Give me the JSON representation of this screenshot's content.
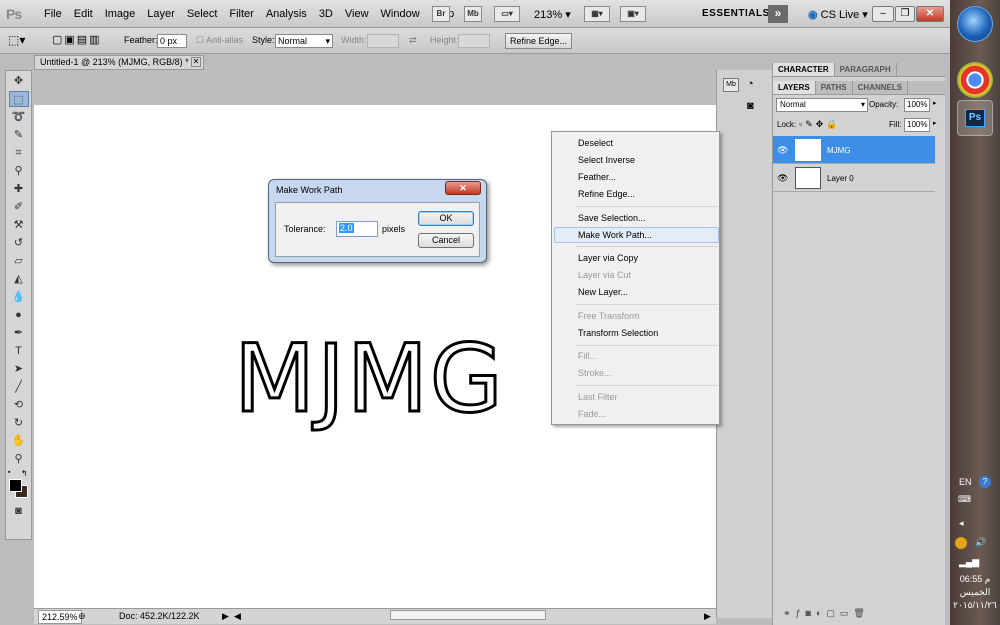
{
  "menubar": {
    "logo": "Ps",
    "menus": [
      "File",
      "Edit",
      "Image",
      "Layer",
      "Select",
      "Filter",
      "Analysis",
      "3D",
      "View",
      "Window",
      "Help"
    ],
    "bridge_icon": "Br",
    "minibridge_icon": "Mb",
    "zoom": "213%",
    "workspace": "ESSENTIALS",
    "cs_live": "CS Live"
  },
  "options": {
    "feather_label": "Feather:",
    "feather_value": "0 px",
    "antialias_label": "Anti-alias",
    "style_label": "Style:",
    "style_value": "Normal",
    "width_label": "Width:",
    "height_label": "Height:",
    "refine_button": "Refine Edge..."
  },
  "document": {
    "tab_title": "Untitled-1 @ 213% (MJMG, RGB/8) *",
    "canvas_text": "MJMG",
    "status_zoom": "212.59%",
    "status_doc": "Doc: 452.2K/122.2K"
  },
  "context_menu": {
    "items": [
      {
        "label": "Deselect",
        "enabled": true
      },
      {
        "label": "Select Inverse",
        "enabled": true
      },
      {
        "label": "Feather...",
        "enabled": true
      },
      {
        "label": "Refine Edge...",
        "enabled": true
      },
      {
        "label": "Save Selection...",
        "enabled": true
      },
      {
        "label": "Make Work Path...",
        "enabled": true,
        "highlighted": true
      },
      {
        "label": "Layer via Copy",
        "enabled": true
      },
      {
        "label": "Layer via Cut",
        "enabled": false
      },
      {
        "label": "New Layer...",
        "enabled": true
      },
      {
        "label": "Free Transform",
        "enabled": false
      },
      {
        "label": "Transform Selection",
        "enabled": true
      },
      {
        "label": "Fill...",
        "enabled": false
      },
      {
        "label": "Stroke...",
        "enabled": false
      },
      {
        "label": "Last Filter",
        "enabled": false
      },
      {
        "label": "Fade...",
        "enabled": false
      }
    ]
  },
  "dialog": {
    "title": "Make Work Path",
    "tolerance_label": "Tolerance:",
    "tolerance_value": "2.0",
    "units": "pixels",
    "ok": "OK",
    "cancel": "Cancel"
  },
  "panels": {
    "top_tabs": [
      "CHARACTER",
      "PARAGRAPH"
    ],
    "tabs": [
      "LAYERS",
      "PATHS",
      "CHANNELS"
    ],
    "blend_mode": "Normal",
    "opacity_label": "Opacity:",
    "opacity_value": "100%",
    "lock_label": "Lock:",
    "fill_label": "Fill:",
    "fill_value": "100%",
    "layers": [
      {
        "name": "MJMG",
        "thumb": "T",
        "selected": true
      },
      {
        "name": "Layer 0",
        "thumb": "",
        "selected": false
      }
    ]
  },
  "taskbar": {
    "ps_label": "Ps",
    "lang": "EN",
    "time": "06:55 م",
    "day": "الخميس",
    "date": "٢٠١٥/١١/٢٦"
  },
  "colors": {
    "selected_layer": "#3d8ee6",
    "menu_highlight": "#e3ecf7",
    "dialog_frame": "#c6d7ee"
  }
}
